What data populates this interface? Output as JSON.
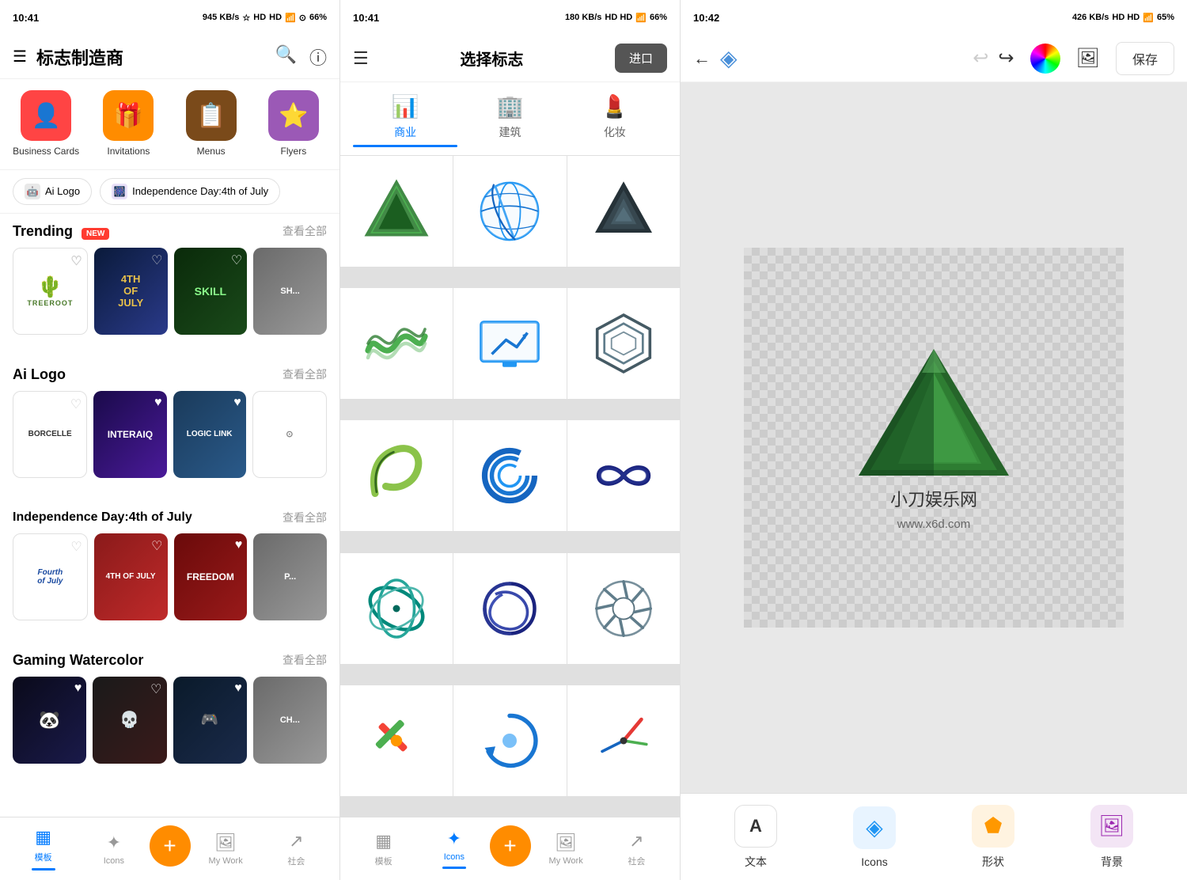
{
  "panel1": {
    "statusBar": {
      "time": "10:41",
      "network": "945 KB/s",
      "icons": "BT HD HD .ill ≈ 66"
    },
    "header": {
      "title": "标志制造商",
      "searchIcon": "🔍",
      "infoIcon": "ⓘ",
      "menuIcon": "☰"
    },
    "categories": [
      {
        "id": "business-cards",
        "icon": "👤",
        "label": "Business Cards",
        "color": "cat-red"
      },
      {
        "id": "invitations",
        "icon": "🎁",
        "label": "Invitations",
        "color": "cat-orange"
      },
      {
        "id": "menus",
        "icon": "📋",
        "label": "Menus",
        "color": "cat-brown"
      },
      {
        "id": "flyers",
        "icon": "⭐",
        "label": "Flyers",
        "color": "cat-purple"
      }
    ],
    "tags": [
      {
        "id": "ai-logo",
        "icon": "🤖",
        "label": "Ai Logo"
      },
      {
        "id": "independence",
        "icon": "🗽",
        "label": "Independence Day:4th of July"
      }
    ],
    "sections": [
      {
        "id": "trending",
        "title": "Trending",
        "hasNew": true,
        "viewAll": "查看全部",
        "cards": [
          {
            "id": "treeroot",
            "type": "light",
            "text": "TREEROOT"
          },
          {
            "id": "4th-july",
            "type": "dark",
            "text": "4TH OF JULY"
          },
          {
            "id": "skill",
            "type": "gaming",
            "text": "SKILL"
          },
          {
            "id": "partial",
            "type": "partial",
            "text": "SH..."
          }
        ]
      },
      {
        "id": "ai-logo",
        "title": "Ai Logo",
        "hasNew": false,
        "viewAll": "查看全部",
        "cards": [
          {
            "id": "borcelle",
            "type": "light",
            "text": "BORCELLE"
          },
          {
            "id": "interaiq",
            "type": "purple",
            "text": "INTERAIQ"
          },
          {
            "id": "logic-link",
            "type": "blue",
            "text": "LOGIC LINK"
          },
          {
            "id": "circle",
            "type": "circle",
            "text": ""
          }
        ]
      },
      {
        "id": "independence",
        "title": "Independence Day:4th of July",
        "hasNew": false,
        "viewAll": "查看全部",
        "cards": [
          {
            "id": "fourth-july",
            "type": "light",
            "text": "Fourth of July"
          },
          {
            "id": "4th-red",
            "type": "red",
            "text": "4TH OF JULY"
          },
          {
            "id": "freedom",
            "type": "darkred",
            "text": "FREEDOM"
          },
          {
            "id": "partial2",
            "type": "partial",
            "text": "P..."
          }
        ]
      },
      {
        "id": "gaming-watercolor",
        "title": "Gaming Watercolor",
        "hasNew": false,
        "viewAll": "查看全部",
        "cards": [
          {
            "id": "gamer1",
            "type": "darkblue",
            "text": ""
          },
          {
            "id": "gamer2",
            "type": "dark",
            "text": ""
          },
          {
            "id": "gamer3",
            "type": "dark",
            "text": ""
          },
          {
            "id": "partial3",
            "type": "partial",
            "text": "CH..."
          }
        ]
      }
    ],
    "bottomTabs": [
      {
        "id": "templates",
        "icon": "▦",
        "label": "模板",
        "active": true
      },
      {
        "id": "icons",
        "icon": "✦",
        "label": "Icons",
        "active": false
      },
      {
        "id": "add",
        "icon": "+",
        "label": "",
        "isAdd": true
      },
      {
        "id": "my-work",
        "icon": "🖼",
        "label": "My Work",
        "active": false
      },
      {
        "id": "social",
        "icon": "↗",
        "label": "社会",
        "active": false
      }
    ]
  },
  "panel2": {
    "statusBar": {
      "time": "10:41",
      "network": "KB/s BT HD HD .ill ≈ 66"
    },
    "header": {
      "title": "选择标志",
      "importLabel": "进口",
      "menuIcon": "☰"
    },
    "tabs": [
      {
        "id": "business",
        "icon": "📊",
        "label": "商业",
        "active": true
      },
      {
        "id": "architecture",
        "icon": "🏢",
        "label": "建筑",
        "active": false
      },
      {
        "id": "cosmetics",
        "icon": "💄",
        "label": "化妆",
        "active": false
      }
    ],
    "logos": [
      {
        "id": "logo1",
        "type": "triangle-green"
      },
      {
        "id": "logo2",
        "type": "globe-blue"
      },
      {
        "id": "logo3",
        "type": "triangle-dark"
      },
      {
        "id": "logo4",
        "type": "waves-green"
      },
      {
        "id": "logo5",
        "type": "arrow-screen"
      },
      {
        "id": "logo6",
        "type": "hexagon"
      },
      {
        "id": "logo7",
        "type": "banana-green"
      },
      {
        "id": "logo8",
        "type": "circle-blue"
      },
      {
        "id": "logo9",
        "type": "infinity-blue"
      },
      {
        "id": "logo10",
        "type": "swirl-teal"
      },
      {
        "id": "logo11",
        "type": "knot-blue"
      },
      {
        "id": "logo12",
        "type": "aperture"
      },
      {
        "id": "logo13",
        "type": "tools-orange"
      },
      {
        "id": "logo14",
        "type": "arrow-circle"
      },
      {
        "id": "logo15",
        "type": "speedometer"
      }
    ],
    "bottomTabs": [
      {
        "id": "templates",
        "icon": "▦",
        "label": "模板",
        "active": false
      },
      {
        "id": "icons",
        "icon": "✦",
        "label": "Icons",
        "active": true
      },
      {
        "id": "add",
        "icon": "+",
        "label": "",
        "isAdd": true
      },
      {
        "id": "my-work",
        "icon": "🖼",
        "label": "My Work",
        "active": false
      },
      {
        "id": "social",
        "icon": "↗",
        "label": "社会",
        "active": false
      }
    ]
  },
  "panel3": {
    "statusBar": {
      "time": "10:42",
      "network": "KB/s BT HD HD .ill ≈ 65"
    },
    "header": {
      "backIcon": "←",
      "layersIcon": "◈",
      "undoDisabled": true,
      "redoEnabled": true,
      "saveLabel": "保存"
    },
    "canvas": {
      "logoTitle": "小刀娱乐网",
      "logoSubtitle": "www.x6d.com"
    },
    "tools": [
      {
        "id": "text",
        "icon": "A",
        "label": "文本",
        "iconClass": "tool-icon-text"
      },
      {
        "id": "icons",
        "icon": "◈",
        "label": "Icons",
        "iconClass": "tool-icon-3d"
      },
      {
        "id": "shapes",
        "icon": "⬟",
        "label": "形状",
        "iconClass": "tool-icon-shape"
      },
      {
        "id": "background",
        "icon": "🖼",
        "label": "背景",
        "iconClass": "tool-icon-bg"
      }
    ]
  }
}
